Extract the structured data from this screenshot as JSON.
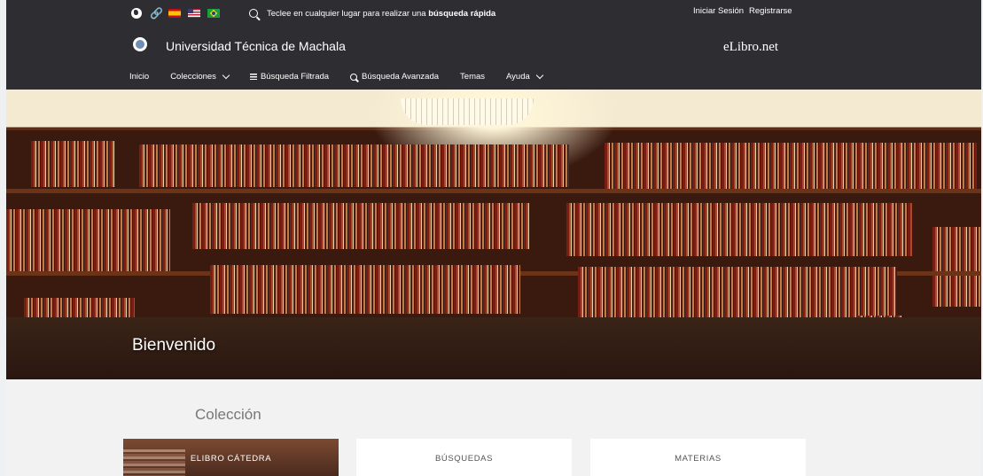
{
  "topbar": {
    "icons": [
      "globe-icon",
      "link-icon",
      "flag-es-icon",
      "flag-us-icon",
      "flag-br-icon",
      "search-icon"
    ],
    "search_prompt": "Teclee en cualquier lugar para realizar una ",
    "search_prompt_bold": "búsqueda rápida",
    "login": "Iniciar Sesión",
    "register": "Registrarse"
  },
  "header": {
    "university": "Universidad Técnica de Machala",
    "brand": "eLibro",
    "brand_suffix": ".net"
  },
  "nav": {
    "items": [
      "Inicio",
      "Colecciones",
      "Búsqueda Filtrada",
      "Búsqueda Avanzada",
      "Temas",
      "Ayuda"
    ]
  },
  "hero": {
    "title": "Bienvenido"
  },
  "collection": {
    "title": "Colección",
    "cards": [
      "ELIBRO CÁTEDRA",
      "BÚSQUEDAS",
      "MATERIAS"
    ]
  },
  "colors": {
    "header_bg": "#2e2e32",
    "page_bg": "#f2f2f2"
  }
}
